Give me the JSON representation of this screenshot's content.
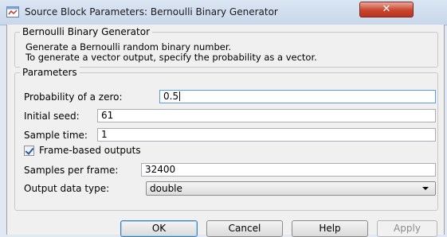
{
  "window": {
    "title": "Source Block Parameters: Bernoulli Binary Generator",
    "close_label": "✕"
  },
  "block": {
    "name": "Bernoulli Binary Generator",
    "description_line1": "Generate a Bernoulli random binary number.",
    "description_line2": "To generate a vector output, specify the probability as a vector."
  },
  "parameters": {
    "heading": "Parameters",
    "probability_label": "Probability of a zero:",
    "probability_value": "0.5",
    "seed_label": "Initial seed:",
    "seed_value": "61",
    "sample_time_label": "Sample time:",
    "sample_time_value": "1",
    "frame_based_label": "Frame-based outputs",
    "frame_based_checked": true,
    "samples_per_frame_label": "Samples per frame:",
    "samples_per_frame_value": "32400",
    "output_type_label": "Output data type:",
    "output_type_value": "double"
  },
  "buttons": {
    "ok": "OK",
    "cancel": "Cancel",
    "help": "Help",
    "apply": "Apply"
  }
}
